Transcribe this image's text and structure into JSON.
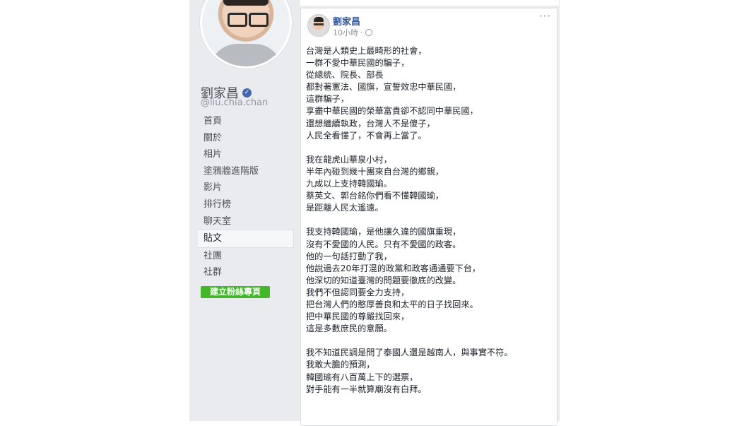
{
  "page": {
    "name": "劉家昌",
    "username": "@liu.chia.chan"
  },
  "nav": {
    "items": [
      {
        "label": "首頁"
      },
      {
        "label": "關於"
      },
      {
        "label": "相片"
      },
      {
        "label": "塗鴉牆進階版"
      },
      {
        "label": "影片"
      },
      {
        "label": "排行榜"
      },
      {
        "label": "聊天室"
      },
      {
        "label": "貼文",
        "active": true
      },
      {
        "label": "社團"
      },
      {
        "label": "社群"
      }
    ],
    "create_page_label": "建立粉絲專頁"
  },
  "post": {
    "author": "劉家昌",
    "time": "10小時",
    "separator": "·",
    "paragraphs": [
      [
        "台灣是人類史上最畸形的社會，",
        "一群不愛中華民國的騙子，",
        "從總統、院長、部長",
        "都對著憲法、國旗，宣誓效忠中華民國，",
        "這群騙子，",
        "享盡中華民國的榮華富貴卻不認同中華民國，",
        "還想繼續執政，台灣人不是傻子，",
        "人民全看懂了，不會再上當了。"
      ],
      [
        "我在龍虎山華泉小村，",
        "半年內碰到幾十團來自台灣的鄉親，",
        "九成以上支持韓國瑜。",
        "蔡英文、郭台銘你們看不懂韓國瑜，",
        "是距離人民太遙遠。"
      ],
      [
        "我支持韓國瑜，是他讓久違的國旗重現，",
        "沒有不愛國的人民。只有不愛國的政客。",
        "他的一句話打動了我，",
        "他說過去20年打混的政黨和政客通通要下台，",
        "他深切的知道臺灣的問題要徹底的改變。",
        "我們不但認同要全力支持，",
        "把台灣人們的憨厚善良和太平的日子找回來。",
        "把中華民國的尊嚴找回來，",
        "這是多數庶民的意願。"
      ],
      [
        "我不知道民調是問了泰國人還是越南人，與事實不符。",
        "我敢大膽的預測，",
        "韓國瑜有八百萬上下的選票，",
        "對手能有一半就算廟沒有白拜。"
      ]
    ]
  },
  "icons": {
    "verified": "verified-badge-icon",
    "privacy": "globe-icon",
    "more": "more-options-icon"
  },
  "colors": {
    "link": "#365899",
    "create_button": "#42b72a",
    "background": "#e9ebee"
  }
}
